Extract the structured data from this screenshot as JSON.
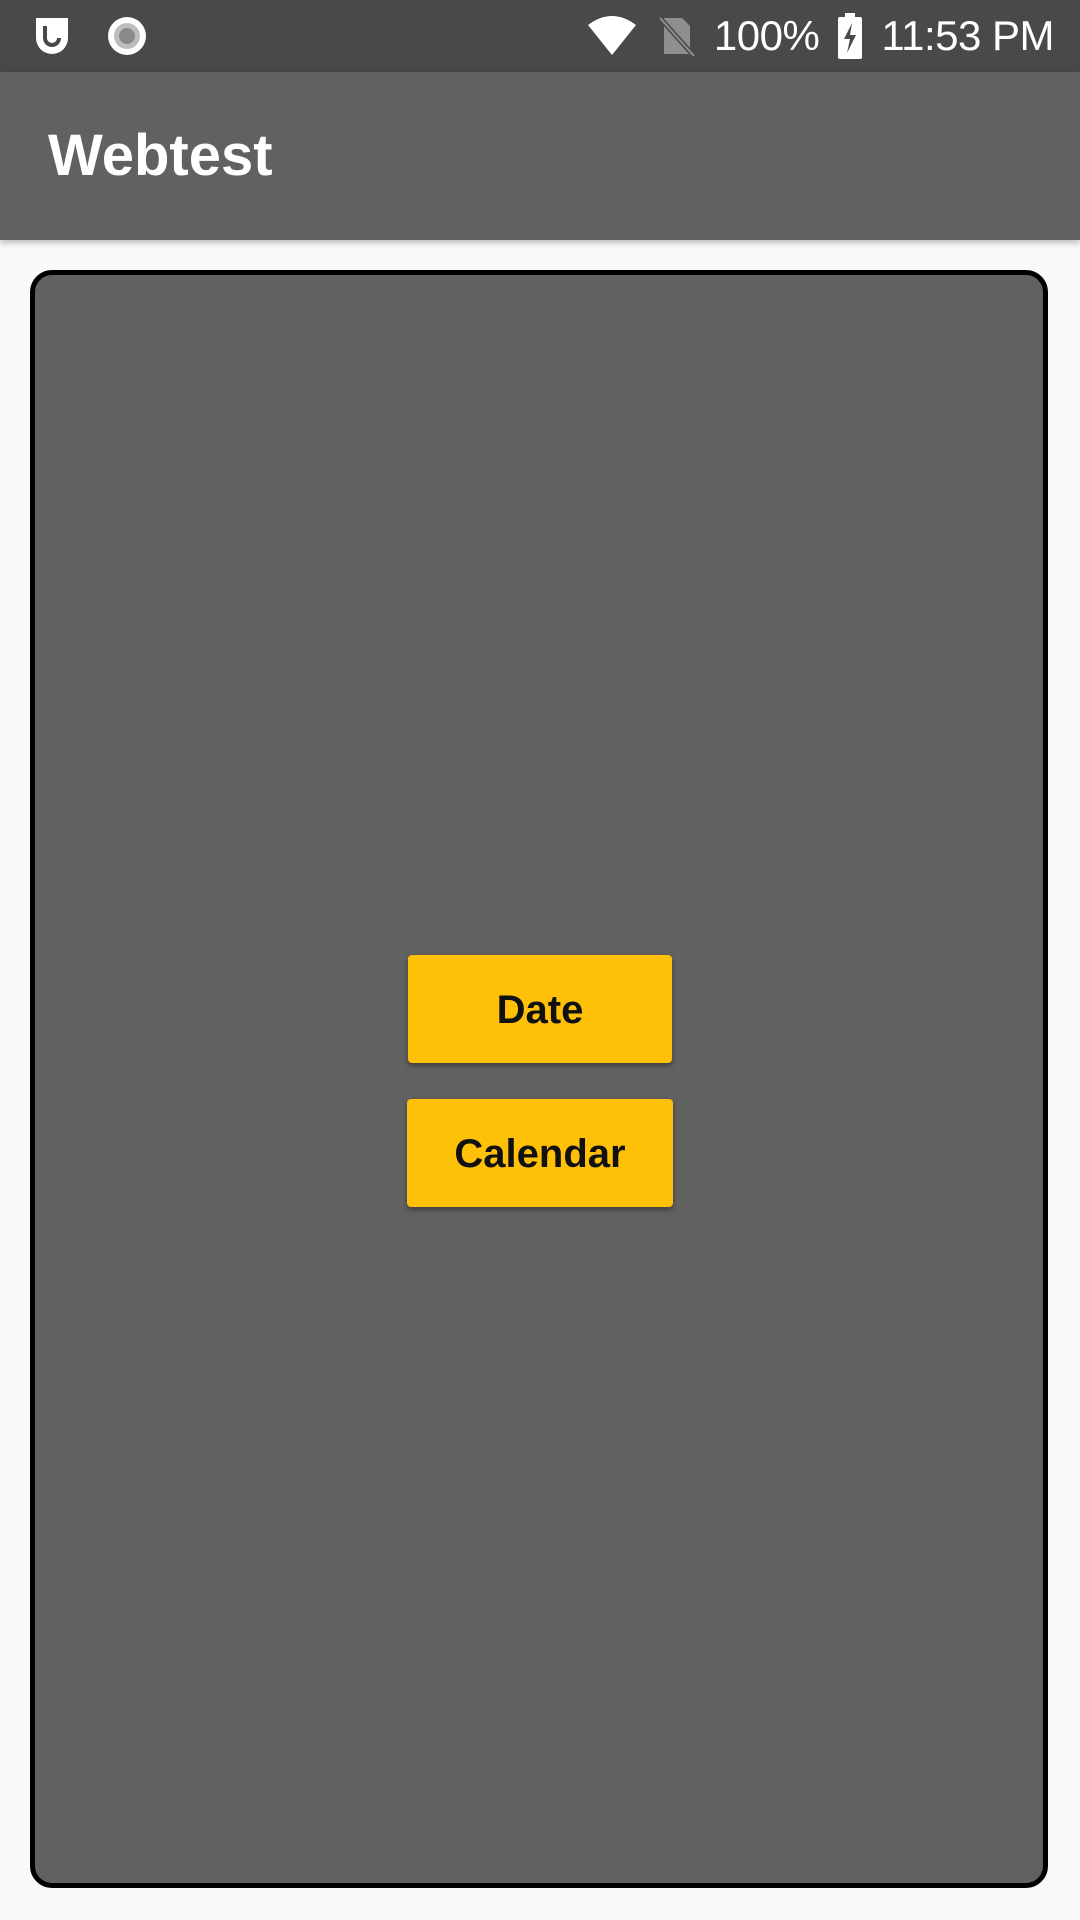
{
  "status_bar": {
    "battery": "100%",
    "time": "11:53 PM",
    "icons": [
      "notification-app-icon",
      "record-icon",
      "wifi-icon",
      "no-sim-icon",
      "battery-charging-icon"
    ]
  },
  "app_bar": {
    "title": "Webtest"
  },
  "main": {
    "buttons": [
      {
        "label": "Date"
      },
      {
        "label": "Calendar"
      }
    ]
  },
  "colors": {
    "status_bar": "#494949",
    "app_bar": "#616161",
    "panel": "#616161",
    "panel_border": "#000000",
    "button": "#ffc107",
    "background": "#fafafa"
  }
}
